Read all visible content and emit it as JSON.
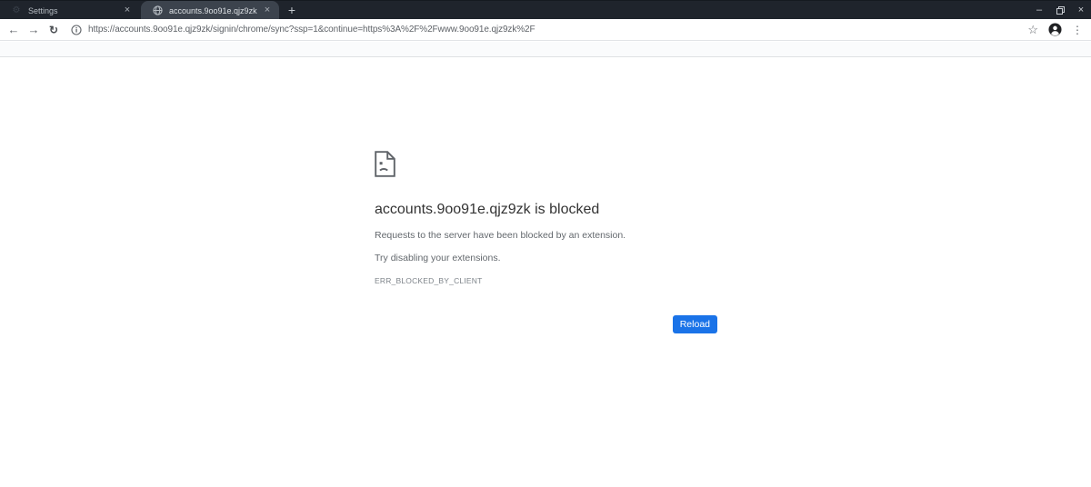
{
  "tab_strip": {
    "tabs": [
      {
        "label": "Settings",
        "active": false
      },
      {
        "label": "accounts.9oo91e.qjz9zk",
        "active": true
      }
    ],
    "icons": {
      "new_tab": "+",
      "close_tab": "×",
      "minimize": "–",
      "close_window": "×"
    }
  },
  "toolbar": {
    "url": "https://accounts.9oo91e.qjz9zk/signin/chrome/sync?ssp=1&continue=https%3A%2F%2Fwww.9oo91e.qjz9zk%2F",
    "icons": {
      "back": "←",
      "forward": "→",
      "reload": "↻",
      "star": "☆",
      "menu": "⋮"
    }
  },
  "error_page": {
    "title": "accounts.9oo91e.qjz9zk is blocked",
    "message": "Requests to the server have been blocked by an extension.",
    "suggestion": "Try disabling your extensions.",
    "error_code": "ERR_BLOCKED_BY_CLIENT",
    "reload_label": "Reload"
  },
  "colors": {
    "tab_strip_bg": "#1f242c",
    "active_tab_bg": "#3c434d",
    "accent_blue": "#1a73e8",
    "title_text": "#333333",
    "body_text": "#63686d",
    "error_code_text": "#7e848a"
  }
}
